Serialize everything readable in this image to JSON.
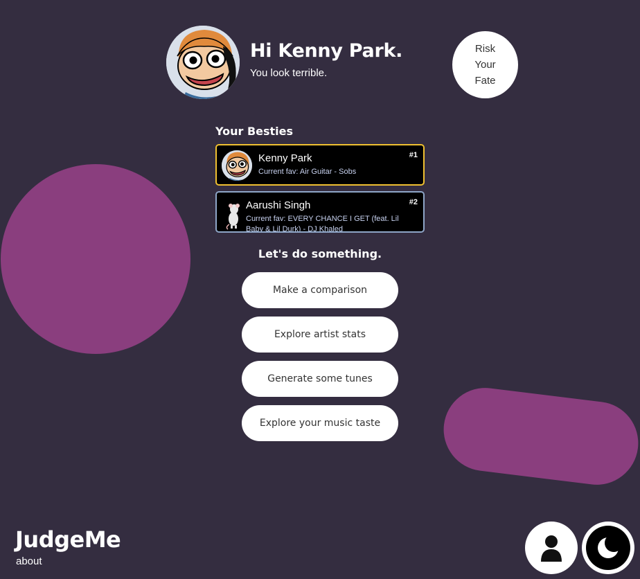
{
  "header": {
    "greeting": "Hi Kenny Park.",
    "subgreeting": "You look terrible.",
    "avatar_icon": "cartoon-face-avatar",
    "risk_button": [
      "Risk",
      "Your",
      "Fate"
    ]
  },
  "besties": {
    "title": "Your Besties",
    "items": [
      {
        "name": "Kenny Park",
        "fav": "Current fav: Air Guitar - Sobs",
        "rank": "#1",
        "border_color": "#f0c030"
      },
      {
        "name": "Aarushi Singh",
        "fav": "Current fav: EVERY CHANCE I GET (feat. Lil Baby & Lil Durk) - DJ Khaled",
        "rank": "#2",
        "border_color": "#8ea6c8"
      }
    ]
  },
  "actions": {
    "title": "Let's do something.",
    "buttons": [
      "Make a comparison",
      "Explore artist stats",
      "Generate some tunes",
      "Explore your music taste"
    ]
  },
  "footer": {
    "brand": "JudgeMe",
    "about": "about",
    "profile_icon": "person-icon",
    "theme_icon": "moon-icon"
  },
  "colors": {
    "background": "#342d40",
    "accent_blob": "#8a3e7e"
  }
}
